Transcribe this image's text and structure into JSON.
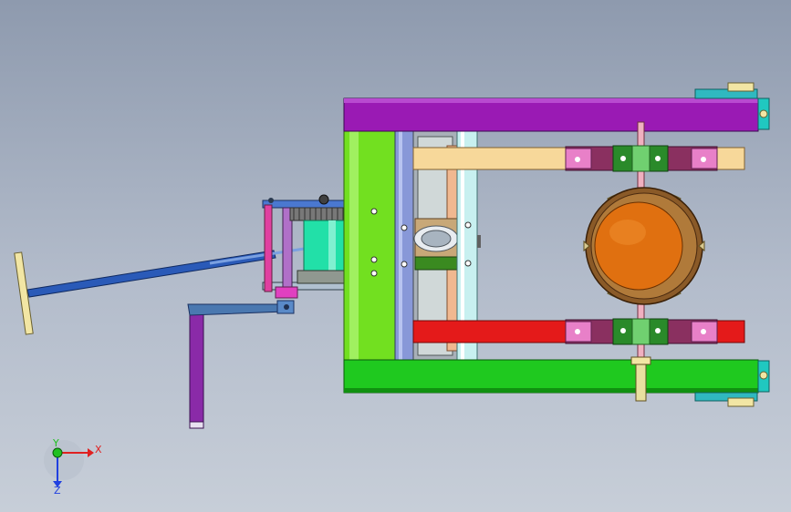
{
  "triad": {
    "x_label": "X",
    "y_label": "Y",
    "z_label": "Z",
    "colors": {
      "x": "#e02020",
      "y": "#20c020",
      "z": "#2040e0"
    }
  },
  "colors": {
    "background_top": "#8e9aae",
    "background_bottom": "#c7ced8",
    "top_bar": "#9a1ab4",
    "bottom_bar": "#1fc91f",
    "green_plate": "#6fe020",
    "cream_rail": "#f7d89a",
    "red_rail": "#e41a1a",
    "orange_drum": "#e07010",
    "teal_tab": "#20c8c0",
    "cyan_motor": "#20e0a0",
    "purple_handle": "#8a2aa8",
    "blue_rod": "#2050b0"
  }
}
